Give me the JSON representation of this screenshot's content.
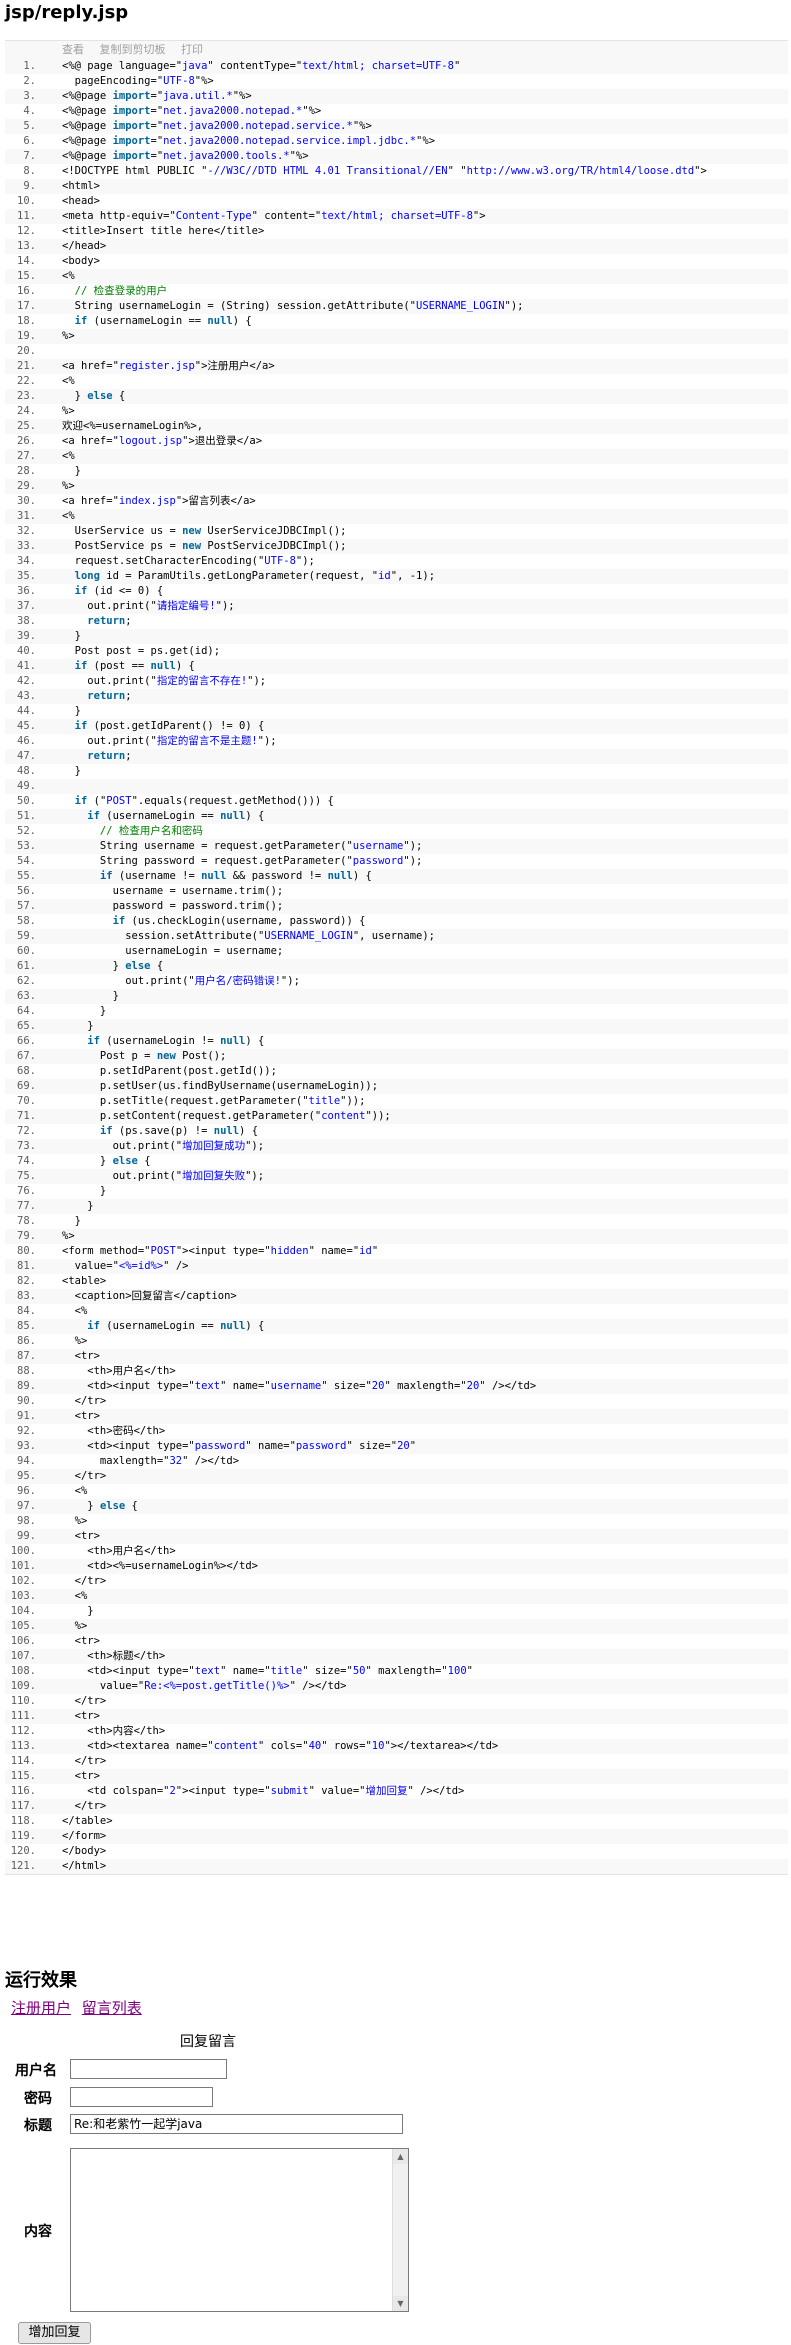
{
  "page_title": "jsp/reply.jsp",
  "toolbar": {
    "view": "查看",
    "copy": "复制到剪切板",
    "print": "打印"
  },
  "code_lines": [
    "<%@ page language=\"java\" contentType=\"text/html; charset=UTF-8\"",
    "  pageEncoding=\"UTF-8\"%>",
    "<%@page import=\"java.util.*\"%>",
    "<%@page import=\"net.java2000.notepad.*\"%>",
    "<%@page import=\"net.java2000.notepad.service.*\"%>",
    "<%@page import=\"net.java2000.notepad.service.impl.jdbc.*\"%>",
    "<%@page import=\"net.java2000.tools.*\"%>",
    "<!DOCTYPE html PUBLIC \"-//W3C//DTD HTML 4.01 Transitional//EN\" \"http://www.w3.org/TR/html4/loose.dtd\">",
    "<html>",
    "<head>",
    "<meta http-equiv=\"Content-Type\" content=\"text/html; charset=UTF-8\">",
    "<title>Insert title here</title>",
    "</head>",
    "<body>",
    "<%",
    "  // 检查登录的用户",
    "  String usernameLogin = (String) session.getAttribute(\"USERNAME_LOGIN\");",
    "  if (usernameLogin == null) {",
    "%>",
    "",
    "<a href=\"register.jsp\">注册用户</a>",
    "<%",
    "  } else {",
    "%>",
    "欢迎<%=usernameLogin%>,",
    "<a href=\"logout.jsp\">退出登录</a>",
    "<%",
    "  }",
    "%>",
    "<a href=\"index.jsp\">留言列表</a>",
    "<%",
    "  UserService us = new UserServiceJDBCImpl();",
    "  PostService ps = new PostServiceJDBCImpl();",
    "  request.setCharacterEncoding(\"UTF-8\");",
    "  long id = ParamUtils.getLongParameter(request, \"id\", -1);",
    "  if (id <= 0) {",
    "    out.print(\"请指定编号!\");",
    "    return;",
    "  }",
    "  Post post = ps.get(id);",
    "  if (post == null) {",
    "    out.print(\"指定的留言不存在!\");",
    "    return;",
    "  }",
    "  if (post.getIdParent() != 0) {",
    "    out.print(\"指定的留言不是主题!\");",
    "    return;",
    "  }",
    "",
    "  if (\"POST\".equals(request.getMethod())) {",
    "    if (usernameLogin == null) {",
    "      // 检查用户名和密码",
    "      String username = request.getParameter(\"username\");",
    "      String password = request.getParameter(\"password\");",
    "      if (username != null && password != null) {",
    "        username = username.trim();",
    "        password = password.trim();",
    "        if (us.checkLogin(username, password)) {",
    "          session.setAttribute(\"USERNAME_LOGIN\", username);",
    "          usernameLogin = username;",
    "        } else {",
    "          out.print(\"用户名/密码错误!\");",
    "        }",
    "      }",
    "    }",
    "    if (usernameLogin != null) {",
    "      Post p = new Post();",
    "      p.setIdParent(post.getId());",
    "      p.setUser(us.findByUsername(usernameLogin));",
    "      p.setTitle(request.getParameter(\"title\"));",
    "      p.setContent(request.getParameter(\"content\"));",
    "      if (ps.save(p) != null) {",
    "        out.print(\"增加回复成功\");",
    "      } else {",
    "        out.print(\"增加回复失败\");",
    "      }",
    "    }",
    "  }",
    "%>",
    "<form method=\"POST\"><input type=\"hidden\" name=\"id\"",
    "  value=\"<%=id%>\" />",
    "<table>",
    "  <caption>回复留言</caption>",
    "  <%",
    "    if (usernameLogin == null) {",
    "  %>",
    "  <tr>",
    "    <th>用户名</th>",
    "    <td><input type=\"text\" name=\"username\" size=\"20\" maxlength=\"20\" /></td>",
    "  </tr>",
    "  <tr>",
    "    <th>密码</th>",
    "    <td><input type=\"password\" name=\"password\" size=\"20\"",
    "      maxlength=\"32\" /></td>",
    "  </tr>",
    "  <%",
    "    } else {",
    "  %>",
    "  <tr>",
    "    <th>用户名</th>",
    "    <td><%=usernameLogin%></td>",
    "  </tr>",
    "  <%",
    "    }",
    "  %>",
    "  <tr>",
    "    <th>标题</th>",
    "    <td><input type=\"text\" name=\"title\" size=\"50\" maxlength=\"100\"",
    "      value=\"Re:<%=post.getTitle()%>\" /></td>",
    "  </tr>",
    "  <tr>",
    "    <th>内容</th>",
    "    <td><textarea name=\"content\" cols=\"40\" rows=\"10\"></textarea></td>",
    "  </tr>",
    "  <tr>",
    "    <td colspan=\"2\"><input type=\"submit\" value=\"增加回复\" /></td>",
    "  </tr>",
    "</table>",
    "</form>",
    "</body>",
    "</html>"
  ],
  "result": {
    "heading": "运行效果",
    "links": [
      "注册用户",
      "留言列表"
    ],
    "caption": "回复留言",
    "labels": {
      "username": "用户名",
      "password": "密码",
      "title": "标题",
      "content": "内容"
    },
    "values": {
      "username": "",
      "password": "",
      "title": "Re:和老紫竹一起学java",
      "content": ""
    },
    "submit_label": "增加回复"
  }
}
